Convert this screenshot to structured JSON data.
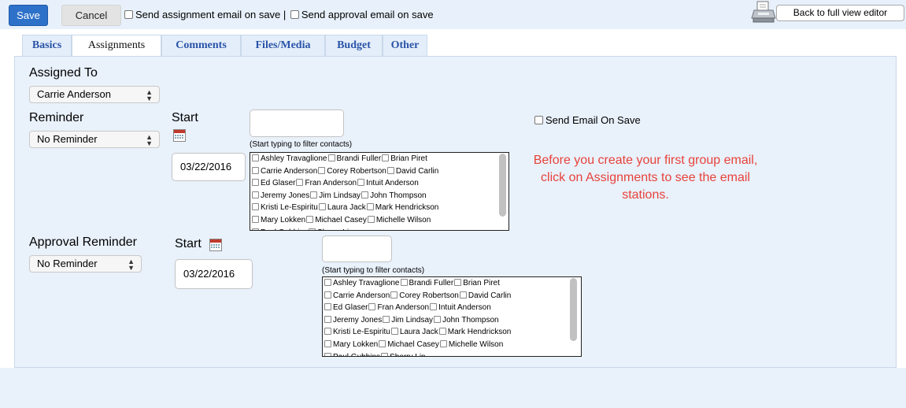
{
  "toolbar": {
    "save_label": "Save",
    "cancel_label": "Cancel",
    "assignment_email_label": "Send assignment email on save |",
    "approval_email_label": "Send approval email on save",
    "back_label": "Back to full view editor"
  },
  "tabs": [
    {
      "label": "Basics",
      "active": false
    },
    {
      "label": "Assignments",
      "active": true
    },
    {
      "label": "Comments",
      "active": false
    },
    {
      "label": "Files/Media",
      "active": false
    },
    {
      "label": "Budget",
      "active": false
    },
    {
      "label": "Other",
      "active": false
    }
  ],
  "assigned_to": {
    "label": "Assigned To",
    "selected": "Carrie Anderson"
  },
  "reminder": {
    "label": "Reminder",
    "selected": "No Reminder",
    "start_label": "Start",
    "start_date": "03/22/2016",
    "filter_hint": "(Start typing to filter contacts)",
    "send_email_label": "Send Email On Save"
  },
  "approval_reminder": {
    "label": "Approval Reminder",
    "selected": "No Reminder",
    "start_label": "Start",
    "start_date": "03/22/2016",
    "filter_hint": "(Start typing to filter contacts)"
  },
  "contact_rows": [
    [
      "Ashley Travaglione",
      "Brandi Fuller",
      "Brian Piret"
    ],
    [
      "Carrie Anderson",
      "Corey Robertson",
      "David Carlin"
    ],
    [
      "Ed Glaser",
      "Fran Anderson",
      "Intuit Anderson"
    ],
    [
      "Jeremy Jones",
      "Jim Lindsay",
      "John Thompson"
    ],
    [
      "Kristi Le-Espiritu",
      "Laura Jack",
      "Mark Hendrickson"
    ],
    [
      "Mary Lokken",
      "Michael Casey",
      "Michelle Wilson"
    ],
    [
      "Paul Gubbins",
      "Sherry Lin"
    ]
  ],
  "note": "Before you create your first group email, click on Assignments to see the email stations.",
  "colors": {
    "save_button": "#2e71c9",
    "tab_text": "#2a53a8",
    "panel_background": "#e9f1fb",
    "note_text": "#e8423a"
  }
}
